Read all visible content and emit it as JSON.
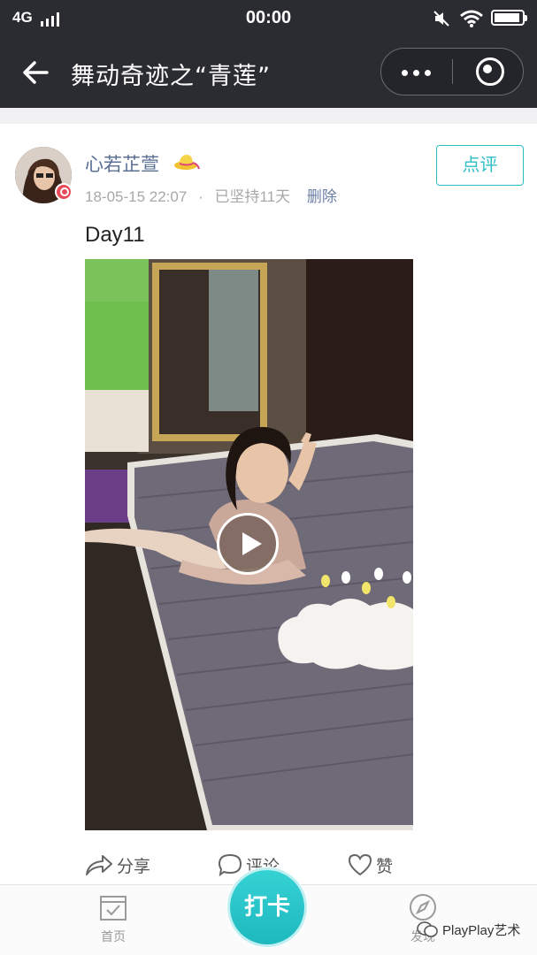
{
  "status_bar": {
    "network": "4G",
    "time": "00:00",
    "battery_level": 0.92
  },
  "nav": {
    "title": "舞动奇迹之“青莲”"
  },
  "post": {
    "username": "心若芷萱",
    "timestamp": "18-05-15 22:07",
    "separator": "·",
    "streak": "已坚持11天",
    "delete_label": "删除",
    "comment_button": "点评",
    "caption": "Day11"
  },
  "actions": {
    "share": "分享",
    "comment": "评论",
    "like": "赞"
  },
  "tabbar": {
    "home": "首页",
    "punch": "打卡",
    "discover": "发现"
  },
  "watermark": "PlayPlay艺术",
  "colors": {
    "header_bg": "#2b2c31",
    "accent_teal": "#2bbec4",
    "username_blue": "#5b6f95"
  }
}
